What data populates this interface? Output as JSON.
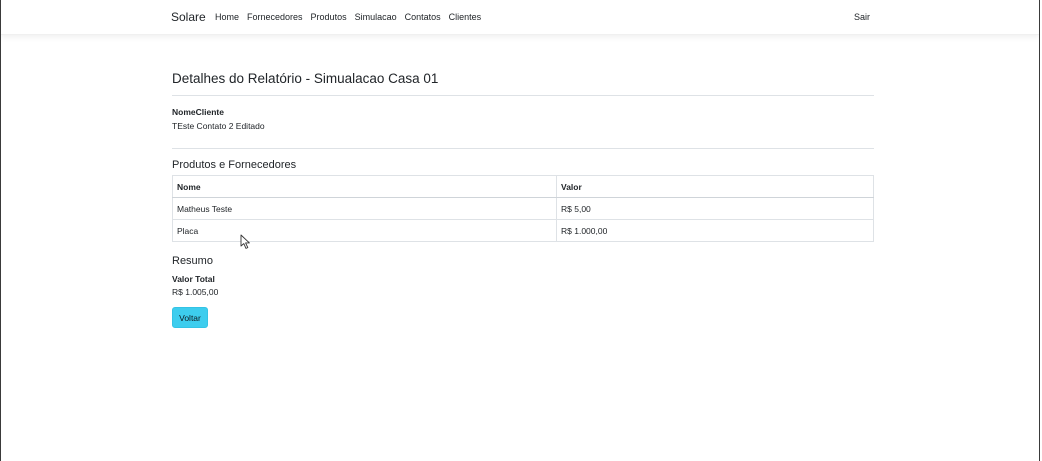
{
  "navbar": {
    "brand": "Solare",
    "links": [
      "Home",
      "Fornecedores",
      "Produtos",
      "Simulacao",
      "Contatos",
      "Clientes"
    ],
    "logout": "Sair"
  },
  "report": {
    "title": "Detalhes do Relatório - Simualacao Casa 01",
    "client_label": "NomeCliente",
    "client_value": "TEste Contato 2 Editado"
  },
  "products_section": {
    "title": "Produtos e Fornecedores",
    "headers": [
      "Nome",
      "Valor"
    ],
    "rows": [
      [
        "Matheus Teste",
        "R$ 5,00"
      ],
      [
        "Placa",
        "R$ 1.000,00"
      ]
    ]
  },
  "summary": {
    "title": "Resumo",
    "total_label": "Valor Total",
    "total_value": "R$ 1.005,00"
  },
  "actions": {
    "back_label": "Voltar"
  },
  "colors": {
    "back_button": "#3dcdee",
    "border": "#dee2e6"
  },
  "icons": {
    "cursor": "mouse-pointer-icon"
  }
}
